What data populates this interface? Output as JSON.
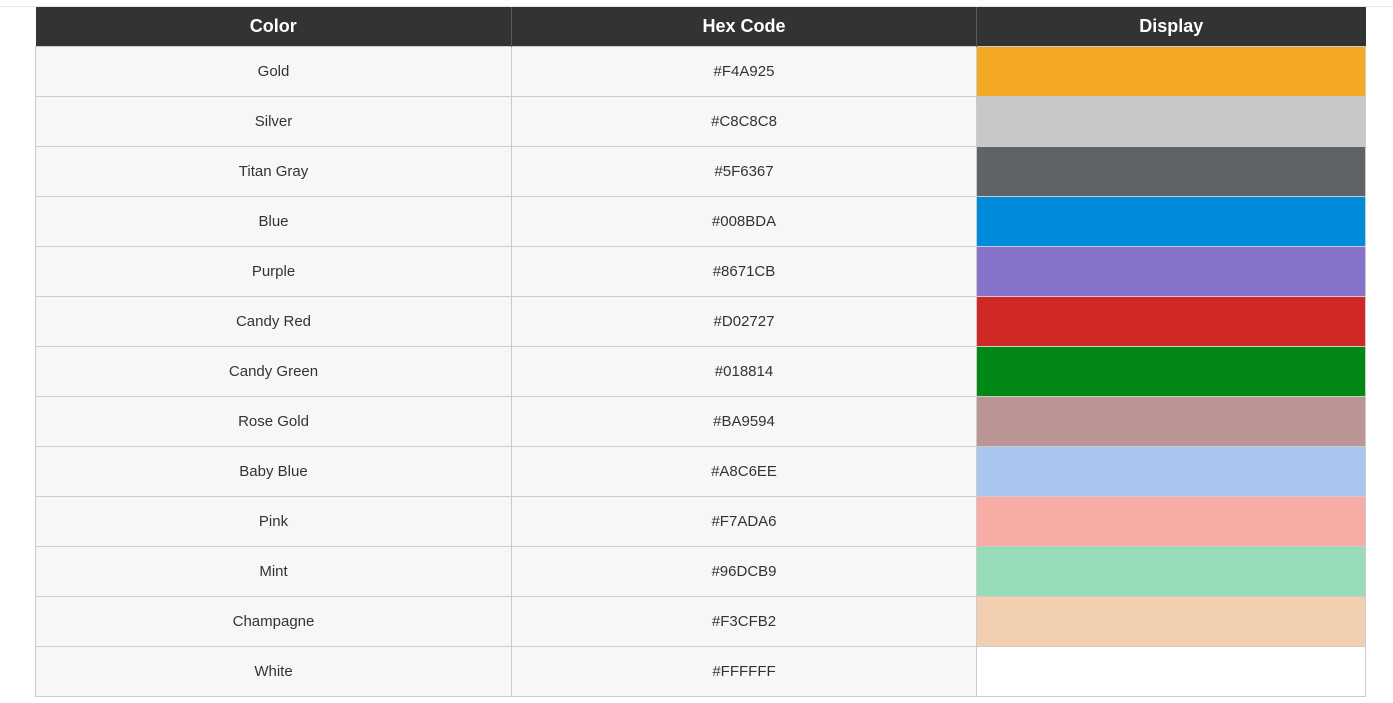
{
  "table": {
    "headers": [
      "Color",
      "Hex Code",
      "Display"
    ],
    "rows": [
      {
        "name": "Gold",
        "hex": "#F4A925",
        "swatch": "#F4A925"
      },
      {
        "name": "Silver",
        "hex": "#C8C8C8",
        "swatch": "#C8C8C8"
      },
      {
        "name": "Titan Gray",
        "hex": "#5F6367",
        "swatch": "#5F6367"
      },
      {
        "name": "Blue",
        "hex": "#008BDA",
        "swatch": "#008BDA"
      },
      {
        "name": "Purple",
        "hex": "#8671CB",
        "swatch": "#8671CB"
      },
      {
        "name": "Candy Red",
        "hex": "#D02727",
        "swatch": "#D02727"
      },
      {
        "name": "Candy Green",
        "hex": "#018814",
        "swatch": "#018814"
      },
      {
        "name": "Rose Gold",
        "hex": "#BA9594",
        "swatch": "#BA9594"
      },
      {
        "name": "Baby Blue",
        "hex": "#A8C6EE",
        "swatch": "#A8C6EE"
      },
      {
        "name": "Pink",
        "hex": "#F7ADA6",
        "swatch": "#F7ADA6"
      },
      {
        "name": "Mint",
        "hex": "#96DCB9",
        "swatch": "#96DCB9"
      },
      {
        "name": "Champagne",
        "hex": "#F3CFB2",
        "swatch": "#F3CFB2"
      },
      {
        "name": "White",
        "hex": "#FFFFFF",
        "swatch": "#FFFFFF"
      }
    ]
  }
}
